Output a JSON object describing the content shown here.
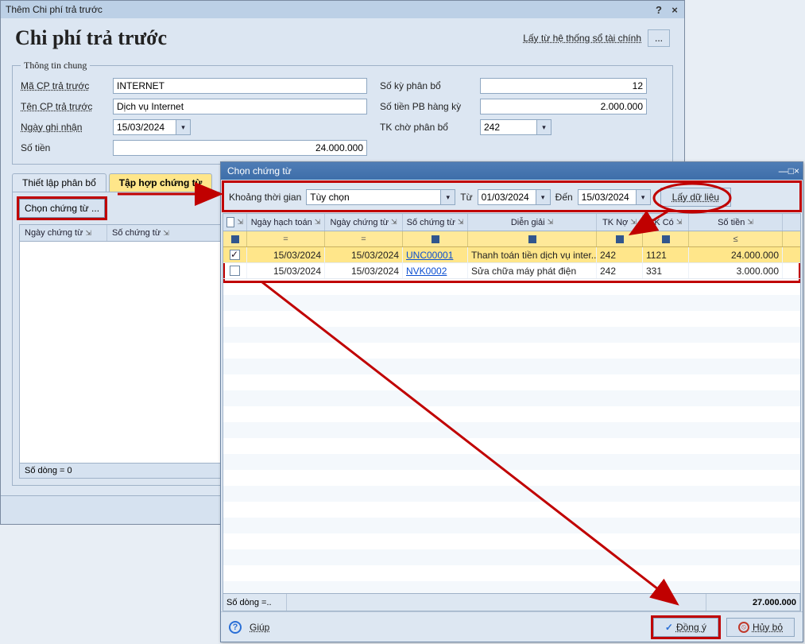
{
  "parent": {
    "titlebar": "Thêm Chi phí trả trước",
    "heading": "Chi phí trả trước",
    "link_get_from_fin": "Lấy từ hệ thống sổ tài chính",
    "ellipsis": "...",
    "fieldset_legend": "Thông tin chung",
    "labels": {
      "code": "Mã CP trả trước",
      "name": "Tên CP trả trước",
      "date": "Ngày ghi nhận",
      "amount": "Số tiền",
      "periods": "Số kỳ phân bổ",
      "per_period": "Số tiền PB hàng kỳ",
      "waiting_acct": "TK chờ phân bổ"
    },
    "values": {
      "code": "INTERNET",
      "name": "Dịch vụ Internet",
      "date": "15/03/2024",
      "amount": "24.000.000",
      "periods": "12",
      "per_period": "2.000.000",
      "waiting_acct": "242"
    },
    "tabs": {
      "tab1": "Thiết lập phân bổ",
      "tab2": "Tập hợp chứng từ"
    },
    "choose_button": "Chọn chứng từ ...",
    "mini_cols": {
      "c1": "Ngày chứng từ",
      "c2": "Số chứng từ"
    },
    "footer_label": "Số dòng = 0"
  },
  "child": {
    "title": "Chọn chứng từ",
    "filter": {
      "range_label": "Khoảng thời gian",
      "range_value": "Tùy chọn",
      "from_label": "Từ",
      "from_value": "01/03/2024",
      "to_label": "Đến",
      "to_value": "15/03/2024",
      "fetch_btn": "Lấy dữ liệu"
    },
    "columns": {
      "posting_date": "Ngày hạch toán",
      "voucher_date": "Ngày chứng từ",
      "voucher_no": "Số chứng từ",
      "description": "Diễn giải",
      "debit_acct": "TK Nợ",
      "credit_acct": "TK Có",
      "amount": "Số tiền"
    },
    "filter_ops": {
      "eq": "=",
      "lte": "≤"
    },
    "rows": [
      {
        "selected": true,
        "posting_date": "15/03/2024",
        "voucher_date": "15/03/2024",
        "voucher_no": "UNC00001",
        "description": "Thanh toán tiền dịch vụ inter...",
        "debit": "242",
        "credit": "1121",
        "amount": "24.000.000"
      },
      {
        "selected": false,
        "posting_date": "15/03/2024",
        "voucher_date": "15/03/2024",
        "voucher_no": "NVK0002",
        "description": "Sửa chữa máy phát điện",
        "debit": "242",
        "credit": "331",
        "amount": "3.000.000"
      }
    ],
    "footer_rowcount": "Số dòng =..",
    "footer_total": "27.000.000",
    "buttons": {
      "help": "Giúp",
      "ok": "Đồng ý",
      "cancel": "Hủy bỏ"
    }
  }
}
